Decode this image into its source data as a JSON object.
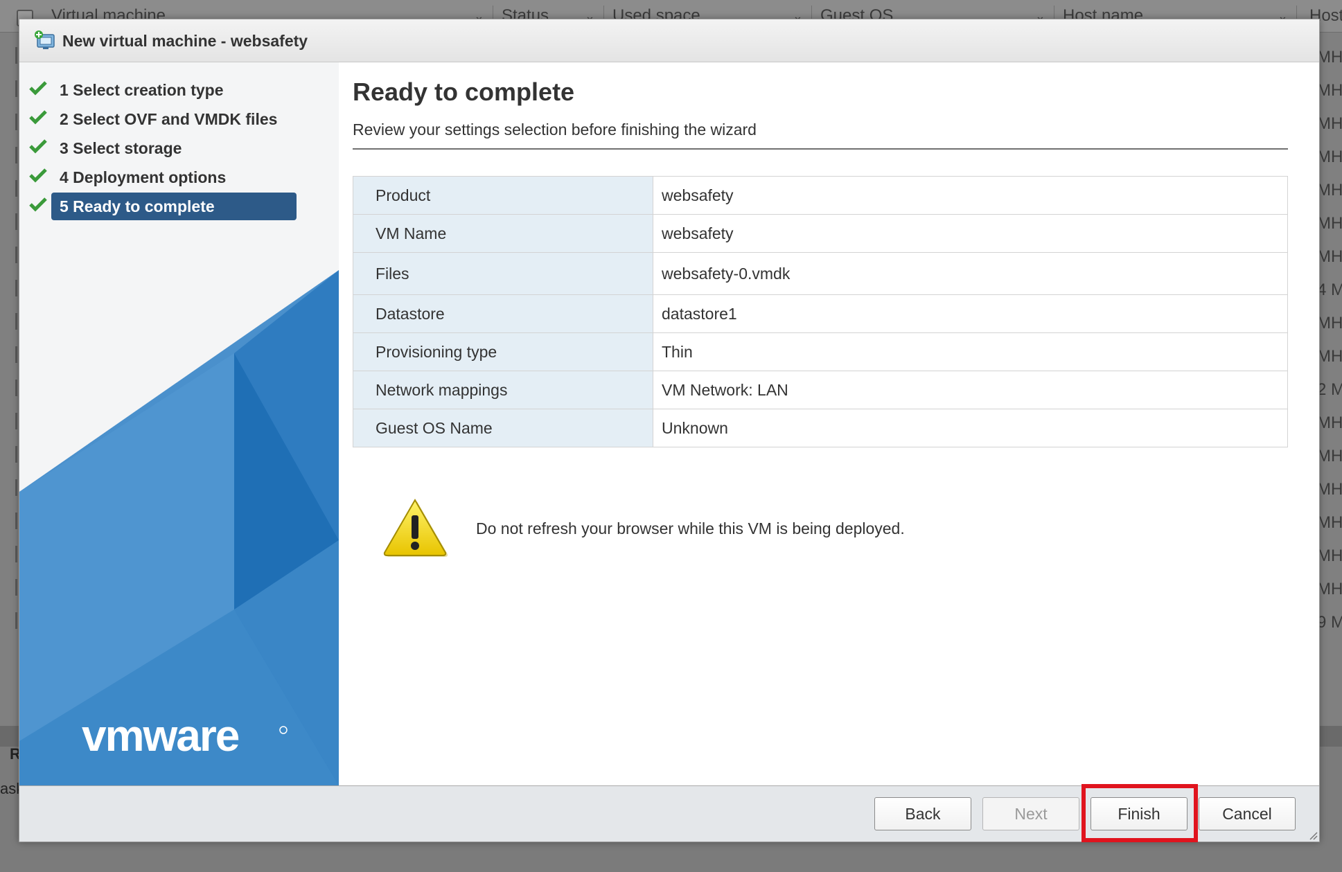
{
  "background": {
    "columns": [
      "Virtual machine",
      "Status",
      "Used space",
      "Guest OS",
      "Host name",
      "Host"
    ],
    "right_cells": [
      "MH",
      "MH",
      "MH",
      "MH",
      "MH",
      "MH",
      "MH",
      "4 M",
      "MH",
      "MH",
      "2 M",
      "MH",
      "MH",
      "MH",
      "MH",
      "MH",
      "MH",
      "9 M"
    ],
    "bottom_label": "R",
    "bottom_label2": "ask"
  },
  "dialog": {
    "title": "New virtual machine - websafety",
    "steps": [
      {
        "label": "1 Select creation type",
        "done": true
      },
      {
        "label": "2 Select OVF and VMDK files",
        "done": true
      },
      {
        "label": "3 Select storage",
        "done": true
      },
      {
        "label": "4 Deployment options",
        "done": true
      },
      {
        "label": "5 Ready to complete",
        "done": true,
        "active": true
      }
    ],
    "logo_text": "vmware",
    "page_title": "Ready to complete",
    "page_subtitle": "Review your settings selection before finishing the wizard",
    "summary": [
      {
        "key": "Product",
        "value": "websafety"
      },
      {
        "key": "VM Name",
        "value": "websafety"
      },
      {
        "key": "Files",
        "value": "websafety-0.vmdk"
      },
      {
        "key": "Datastore",
        "value": "datastore1"
      },
      {
        "key": "Provisioning type",
        "value": "Thin"
      },
      {
        "key": "Network mappings",
        "value": "VM Network: LAN"
      },
      {
        "key": "Guest OS Name",
        "value": "Unknown"
      }
    ],
    "warning": "Do not refresh your browser while this VM is being deployed.",
    "buttons": {
      "back": "Back",
      "next": "Next",
      "finish": "Finish",
      "cancel": "Cancel"
    },
    "colors": {
      "active_step": "#2d5a88",
      "check": "#3a9a3a",
      "highlight": "#e0141e",
      "table_key_bg": "#e4eef5"
    }
  }
}
